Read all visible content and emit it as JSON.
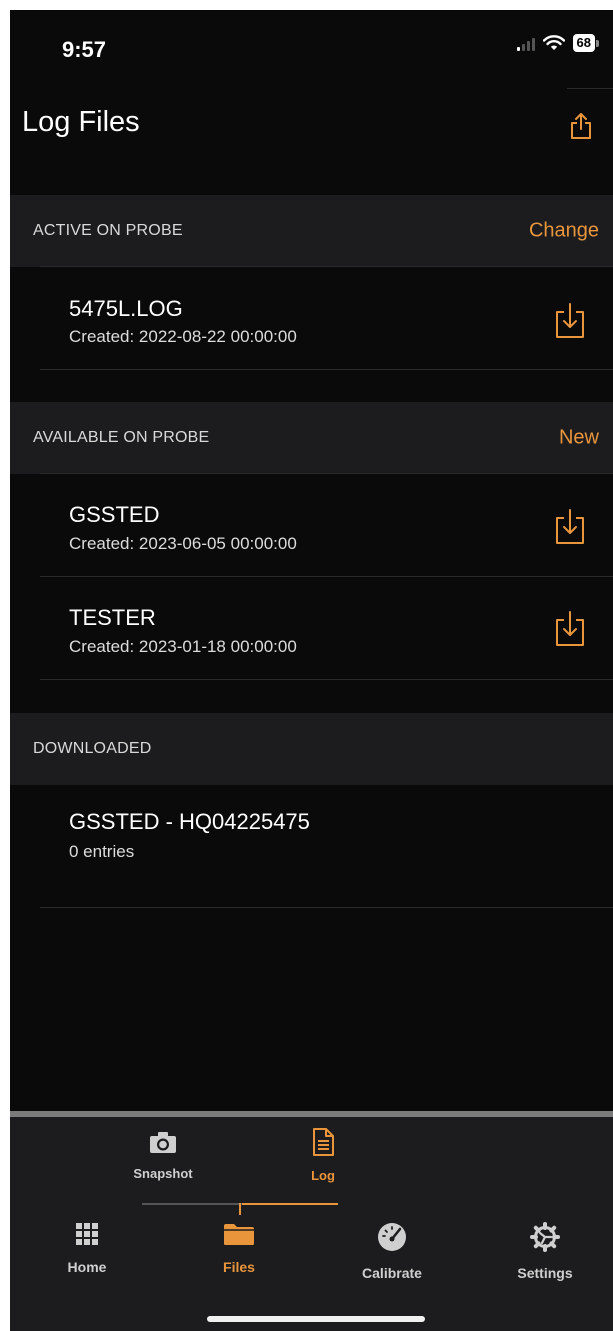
{
  "status_bar": {
    "time": "9:57",
    "battery": "68"
  },
  "header": {
    "title": "Log Files",
    "share_icon": "share-icon"
  },
  "colors": {
    "accent": "#e8953b",
    "background": "#0a0a0a",
    "section": "#1c1c1e"
  },
  "sections": [
    {
      "label": "ACTIVE ON PROBE",
      "action": "Change",
      "items": [
        {
          "title": "5475L.LOG",
          "subtitle": "Created: 2022-08-22 00:00:00"
        }
      ]
    },
    {
      "label": "AVAILABLE ON PROBE",
      "action": "New",
      "items": [
        {
          "title": "GSSTED",
          "subtitle": "Created: 2023-06-05 00:00:00"
        },
        {
          "title": "TESTER",
          "subtitle": "Created: 2023-01-18 00:00:00"
        }
      ]
    },
    {
      "label": "DOWNLOADED",
      "items": [
        {
          "title": "GSSTED - HQ04225475",
          "subtitle": "0 entries"
        }
      ]
    }
  ],
  "sub_tabs": [
    {
      "label": "Snapshot",
      "icon": "camera-icon",
      "active": false
    },
    {
      "label": "Log",
      "icon": "document-icon",
      "active": true
    }
  ],
  "main_tabs": [
    {
      "label": "Home",
      "icon": "grid-icon",
      "active": false
    },
    {
      "label": "Files",
      "icon": "folder-icon",
      "active": true
    },
    {
      "label": "Calibrate",
      "icon": "gauge-icon",
      "active": false
    },
    {
      "label": "Settings",
      "icon": "gear-icon",
      "active": false
    }
  ]
}
